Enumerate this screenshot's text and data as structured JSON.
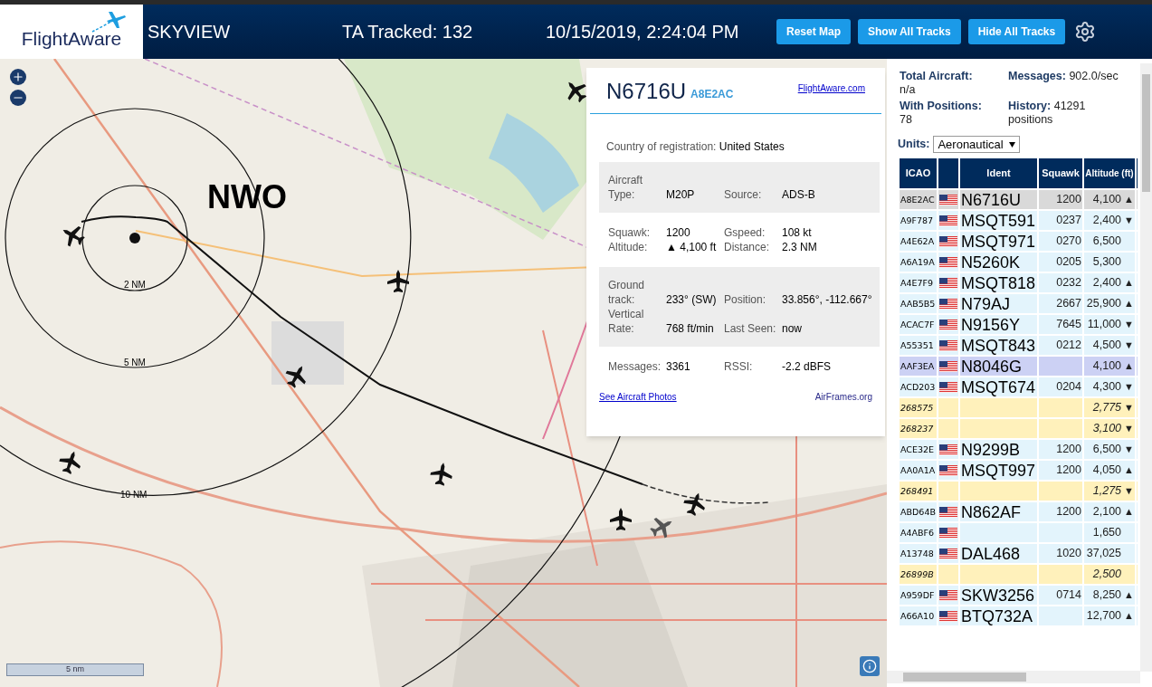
{
  "header": {
    "logo": "FlightAware",
    "title": "SKYVIEW",
    "tracked": "TA Tracked: 132",
    "datetime": "10/15/2019, 2:24:04 PM",
    "buttons": [
      "Reset Map",
      "Show All Tracks",
      "Hide All Tracks"
    ]
  },
  "map": {
    "kind": "picture",
    "callsign_label": "NWO",
    "rings": [
      "2 NM",
      "5 NM",
      "10 NM"
    ],
    "scale_label": "5 nm"
  },
  "popup": {
    "ident": "N6716U",
    "icao": "A8E2AC",
    "link": "FlightAware.com",
    "country_label": "Country of registration:",
    "country": "United States",
    "sections": [
      {
        "shaded": true,
        "fields": [
          {
            "label": "Aircraft Type:",
            "value": "M20P"
          },
          {
            "label": "Source:",
            "value": "ADS-B"
          }
        ]
      },
      {
        "shaded": false,
        "fields": [
          {
            "label": "Squawk:",
            "value": "1200"
          },
          {
            "label": "Gspeed:",
            "value": "108 kt"
          },
          {
            "label": "Altitude:",
            "value": "▲ 4,100 ft"
          },
          {
            "label": "Distance:",
            "value": "2.3 NM"
          }
        ]
      },
      {
        "shaded": true,
        "fields": [
          {
            "label": "Ground track:",
            "value": "233° (SW)"
          },
          {
            "label": "Position:",
            "value": "33.856°, -112.667°"
          },
          {
            "label": "Vertical Rate:",
            "value": "768 ft/min"
          },
          {
            "label": "Last Seen:",
            "value": "now"
          }
        ]
      },
      {
        "shaded": false,
        "fields": [
          {
            "label": "Messages:",
            "value": "3361"
          },
          {
            "label": "RSSI:",
            "value": "-2.2 dBFS"
          }
        ]
      }
    ],
    "photos_link": "See Aircraft Photos",
    "airframes_link": "AirFrames.org"
  },
  "stats": [
    {
      "label": "Total Aircraft:",
      "value": "n/a"
    },
    {
      "label": "Messages:",
      "value": "902.0/sec"
    },
    {
      "label": "With Positions:",
      "value": "78"
    },
    {
      "label": "History:",
      "value": "41291 positions"
    }
  ],
  "units": {
    "label": "Units:",
    "value": "Aeronautical"
  },
  "table": {
    "columns": [
      "ICAO",
      "Ident",
      "Squawk",
      "Altitude (ft)"
    ],
    "rows": [
      {
        "kind": "adsb",
        "selected": true,
        "highlighted": false,
        "flag": true,
        "icao": "A8E2AC",
        "ident": "N6716U",
        "squawk": "1200",
        "altitude": "4,100",
        "trend": "▲"
      },
      {
        "kind": "adsb",
        "selected": false,
        "highlighted": false,
        "flag": true,
        "icao": "A9F787",
        "ident": "MSQT591",
        "squawk": "0237",
        "altitude": "2,400",
        "trend": "▼"
      },
      {
        "kind": "adsb",
        "selected": false,
        "highlighted": false,
        "flag": true,
        "icao": "A4E62A",
        "ident": "MSQT971",
        "squawk": "0270",
        "altitude": "6,500"
      },
      {
        "kind": "adsb",
        "selected": false,
        "highlighted": false,
        "flag": true,
        "icao": "A6A19A",
        "ident": "N5260K",
        "squawk": "0205",
        "altitude": "5,300"
      },
      {
        "kind": "adsb",
        "selected": false,
        "highlighted": false,
        "flag": true,
        "icao": "A4E7F9",
        "ident": "MSQT818",
        "squawk": "0232",
        "altitude": "2,400",
        "trend": "▲"
      },
      {
        "kind": "adsb",
        "selected": false,
        "highlighted": false,
        "flag": true,
        "icao": "AAB5B5",
        "ident": "N79AJ",
        "squawk": "2667",
        "altitude": "25,900",
        "trend": "▲"
      },
      {
        "kind": "adsb",
        "selected": false,
        "highlighted": false,
        "flag": true,
        "icao": "ACAC7F",
        "ident": "N9156Y",
        "squawk": "7645",
        "altitude": "11,000",
        "trend": "▼"
      },
      {
        "kind": "adsb",
        "selected": false,
        "highlighted": false,
        "flag": true,
        "icao": "A55351",
        "ident": "MSQT843",
        "squawk": "0212",
        "altitude": "4,500",
        "trend": "▼"
      },
      {
        "kind": "adsb",
        "selected": false,
        "highlighted": true,
        "flag": true,
        "icao": "AAF3EA",
        "ident": "N8046G",
        "altitude": "4,100",
        "trend": "▲"
      },
      {
        "kind": "adsb",
        "selected": false,
        "highlighted": false,
        "flag": true,
        "icao": "ACD203",
        "ident": "MSQT674",
        "squawk": "0204",
        "altitude": "4,300",
        "trend": "▼"
      },
      {
        "kind": "tisb",
        "selected": false,
        "highlighted": false,
        "flag": false,
        "icao": "268575",
        "altitude": "2,775",
        "trend": "▼"
      },
      {
        "kind": "tisb",
        "selected": false,
        "highlighted": false,
        "flag": false,
        "icao": "268237",
        "altitude": "3,100",
        "trend": "▼"
      },
      {
        "kind": "adsb",
        "selected": false,
        "highlighted": false,
        "flag": true,
        "icao": "ACE32E",
        "ident": "N9299B",
        "squawk": "1200",
        "altitude": "6,500",
        "trend": "▼"
      },
      {
        "kind": "adsb",
        "selected": false,
        "highlighted": false,
        "flag": true,
        "icao": "AA0A1A",
        "ident": "MSQT997",
        "squawk": "1200",
        "altitude": "4,050",
        "trend": "▲"
      },
      {
        "kind": "tisb",
        "selected": false,
        "highlighted": false,
        "flag": false,
        "icao": "268491",
        "altitude": "1,275",
        "trend": "▼"
      },
      {
        "kind": "adsb",
        "selected": false,
        "highlighted": false,
        "flag": true,
        "icao": "ABD64B",
        "ident": "N862AF",
        "squawk": "1200",
        "altitude": "2,100",
        "trend": "▲"
      },
      {
        "kind": "adsb",
        "selected": false,
        "highlighted": false,
        "flag": true,
        "icao": "A4ABF6",
        "altitude": "1,650"
      },
      {
        "kind": "adsb",
        "selected": false,
        "highlighted": false,
        "flag": true,
        "icao": "A13748",
        "ident": "DAL468",
        "squawk": "1020",
        "altitude": "37,025"
      },
      {
        "kind": "tisb",
        "selected": false,
        "highlighted": false,
        "flag": false,
        "icao": "26899B",
        "altitude": "2,500"
      },
      {
        "kind": "adsb",
        "selected": false,
        "highlighted": false,
        "flag": true,
        "icao": "A959DF",
        "ident": "SKW3256",
        "squawk": "0714",
        "altitude": "8,250",
        "trend": "▲"
      },
      {
        "kind": "adsb",
        "selected": false,
        "highlighted": false,
        "flag": true,
        "icao": "A66A10",
        "ident": "BTQ732A",
        "altitude": "12,700",
        "trend": "▲"
      }
    ]
  }
}
